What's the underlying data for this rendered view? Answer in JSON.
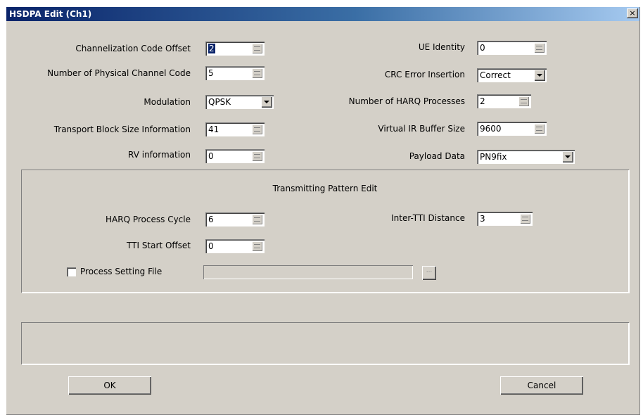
{
  "window": {
    "title": "HSDPA Edit (Ch1)",
    "close_glyph": "×"
  },
  "left": {
    "channelization_code_offset": {
      "label": "Channelization Code Offset",
      "value": "2"
    },
    "num_physical_channel_code": {
      "label": "Number of Physical Channel Code",
      "value": "5"
    },
    "modulation": {
      "label": "Modulation",
      "value": "QPSK"
    },
    "transport_block_size": {
      "label": "Transport Block Size Information",
      "value": "41"
    },
    "rv_information": {
      "label": "RV information",
      "value": "0"
    }
  },
  "right": {
    "ue_identity": {
      "label": "UE Identity",
      "value": "0"
    },
    "crc_error_insertion": {
      "label": "CRC Error Insertion",
      "value": "Correct"
    },
    "num_harq_processes": {
      "label": "Number of HARQ Processes",
      "value": "2"
    },
    "virtual_ir_buffer": {
      "label": "Virtual IR Buffer Size",
      "value": "9600"
    },
    "payload_data": {
      "label": "Payload Data",
      "value": "PN9fix"
    }
  },
  "pattern": {
    "title": "Transmitting Pattern Edit",
    "harq_process_cycle": {
      "label": "HARQ Process Cycle",
      "value": "6"
    },
    "inter_tti_distance": {
      "label": "Inter-TTI Distance",
      "value": "3"
    },
    "tti_start_offset": {
      "label": "TTI Start Offset",
      "value": "0"
    },
    "process_setting_file": {
      "label": "Process Setting File",
      "checked": false,
      "path": ""
    },
    "browse_label": "..."
  },
  "message": "",
  "buttons": {
    "ok": "OK",
    "cancel": "Cancel"
  },
  "icons": {
    "spin": "spin-arrows-icon",
    "dropdown": "chevron-down-icon",
    "close": "close-icon"
  },
  "colors": {
    "face": "#d4d0c8",
    "title_start": "#0a246a",
    "title_end": "#a6caf0",
    "selection": "#0a246a"
  }
}
